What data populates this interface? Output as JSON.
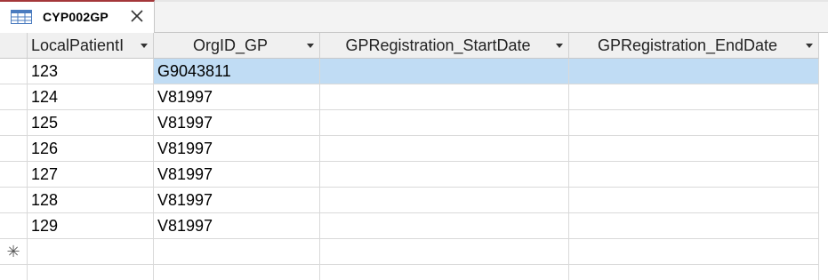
{
  "tab": {
    "title": "CYP002GP",
    "icon": "table-icon",
    "close_icon": "close-icon"
  },
  "columns": [
    {
      "label": "LocalPatientI"
    },
    {
      "label": "OrgID_GP"
    },
    {
      "label": "GPRegistration_StartDate"
    },
    {
      "label": "GPRegistration_EndDate"
    }
  ],
  "rows": [
    [
      "123",
      "G9043811",
      "",
      ""
    ],
    [
      "124",
      "V81997",
      "",
      ""
    ],
    [
      "125",
      "V81997",
      "",
      ""
    ],
    [
      "126",
      "V81997",
      "",
      ""
    ],
    [
      "127",
      "V81997",
      "",
      ""
    ],
    [
      "128",
      "V81997",
      "",
      ""
    ],
    [
      "129",
      "V81997",
      "",
      ""
    ]
  ],
  "new_row_marker": "✳",
  "colors": {
    "selection": "#c0dcf4",
    "tab_accent": "#a4373a"
  }
}
